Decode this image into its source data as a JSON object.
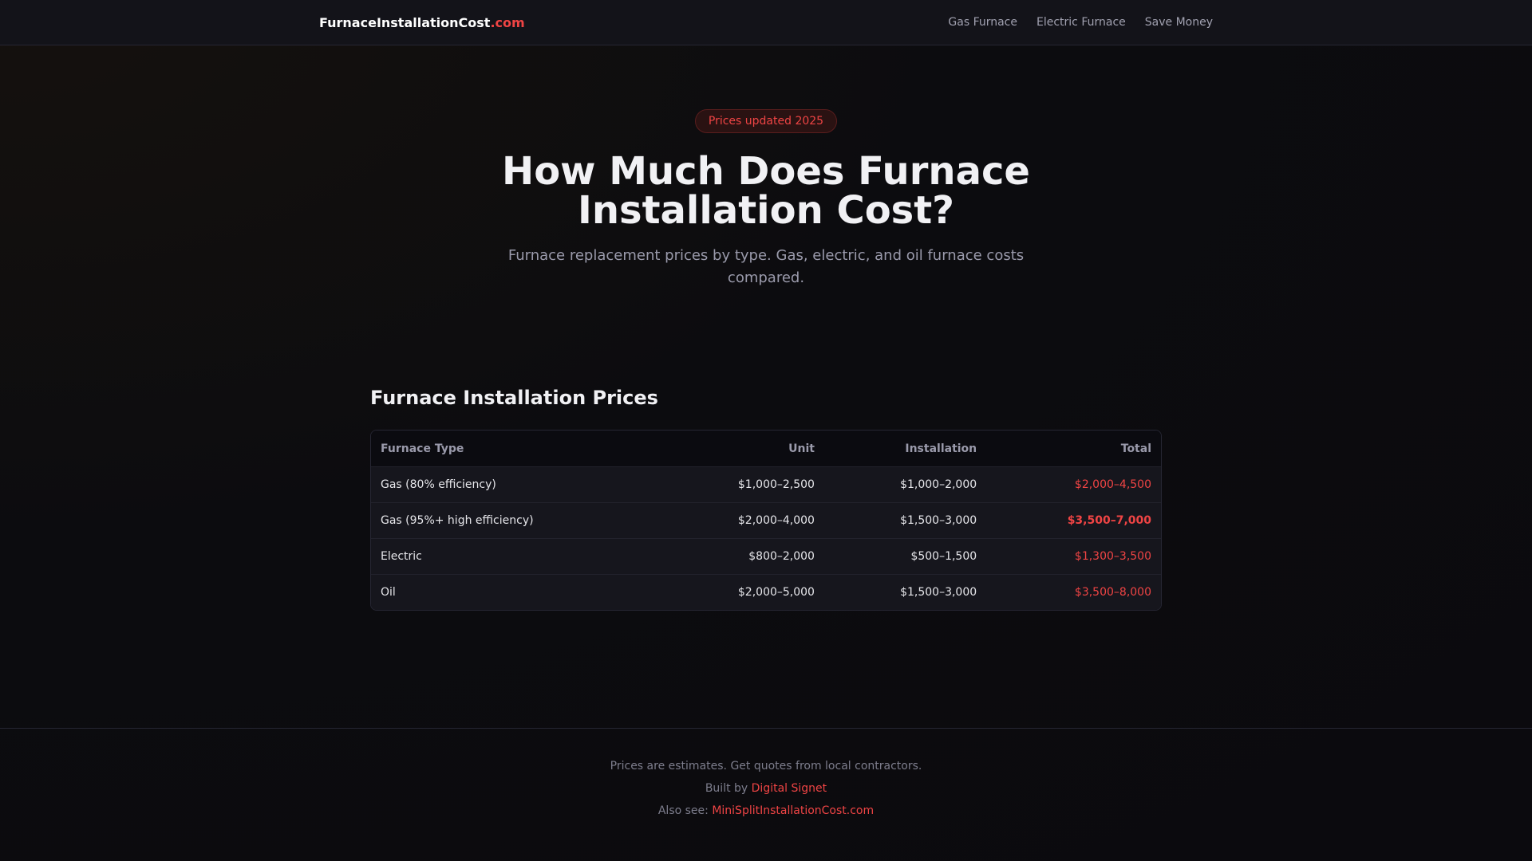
{
  "nav": {
    "logo_main": "FurnaceInstallationCost",
    "logo_tld": ".com",
    "links": [
      "Gas Furnace",
      "Electric Furnace",
      "Save Money"
    ]
  },
  "hero": {
    "badge": "Prices updated 2025",
    "title": "How Much Does Furnace Installation Cost?",
    "subtitle": "Furnace replacement prices by type. Gas, electric, and oil furnace costs compared."
  },
  "prices": {
    "heading": "Furnace Installation Prices",
    "columns": [
      "Furnace Type",
      "Unit",
      "Installation",
      "Total"
    ],
    "rows": [
      [
        "Gas (80% efficiency)",
        "$1,000–2,500",
        "$1,000–2,000",
        "$2,000–4,500"
      ],
      [
        "Gas (95%+ high efficiency)",
        "$2,000–4,000",
        "$1,500–3,000",
        "$3,500–7,000"
      ],
      [
        "Electric",
        "$800–2,000",
        "$500–1,500",
        "$1,300–3,500"
      ],
      [
        "Oil",
        "$2,000–5,000",
        "$1,500–3,000",
        "$3,500–8,000"
      ]
    ]
  },
  "footer": {
    "disclaimer": "Prices are estimates. Get quotes from local contractors.",
    "built_by": "Built by ",
    "built_by_link": "Digital Signet",
    "also_see": "Also see: ",
    "also_see_link": "MiniSplitInstallationCost.com"
  },
  "colors": {
    "accent": "#ef4444"
  }
}
